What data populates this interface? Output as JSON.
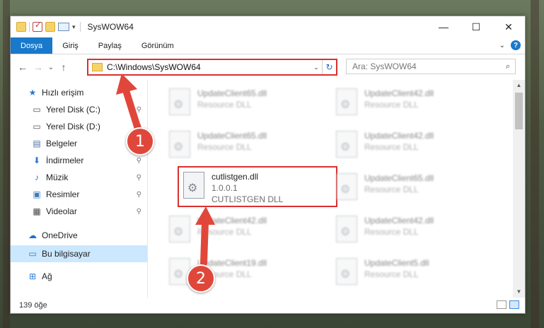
{
  "window": {
    "title": "SysWOW64",
    "controls": {
      "minimize": "—",
      "maximize": "☐",
      "close": "✕"
    }
  },
  "ribbon": {
    "tabs": [
      "Dosya",
      "Giriş",
      "Paylaş",
      "Görünüm"
    ],
    "help": "?",
    "expand": "⌄"
  },
  "nav": {
    "back": "←",
    "forward": "→",
    "recent": "⌄",
    "up": "↑",
    "address": "C:\\Windows\\SysWOW64",
    "refresh": "↻",
    "search_placeholder": "Ara: SysWOW64"
  },
  "sidebar": {
    "items": [
      {
        "label": "Hızlı erişim",
        "icon": "star-icon",
        "pinned": false
      },
      {
        "label": "Yerel Disk (C:)",
        "icon": "drive-icon",
        "pinned": true
      },
      {
        "label": "Yerel Disk (D:)",
        "icon": "drive-icon",
        "pinned": true
      },
      {
        "label": "Belgeler",
        "icon": "documents-icon",
        "pinned": true
      },
      {
        "label": "İndirmeler",
        "icon": "download-icon",
        "pinned": true
      },
      {
        "label": "Müzik",
        "icon": "music-icon",
        "pinned": true
      },
      {
        "label": "Resimler",
        "icon": "pictures-icon",
        "pinned": true
      },
      {
        "label": "Videolar",
        "icon": "video-icon",
        "pinned": true
      },
      {
        "label": "OneDrive",
        "icon": "cloud-icon",
        "pinned": false
      },
      {
        "label": "Bu bilgisayar",
        "icon": "computer-icon",
        "pinned": false,
        "selected": true
      },
      {
        "label": "Ağ",
        "icon": "network-icon",
        "pinned": false
      }
    ],
    "pin_glyph": "📌"
  },
  "files": {
    "left": [
      {
        "name": "UpdateClient65.dll",
        "type": "Resource DLL"
      },
      {
        "name": "UpdateClient65.dll",
        "type": "Resource DLL"
      },
      {
        "name": "cutlistgen.dll",
        "version": "1.0.0.1",
        "type": "CUTLISTGEN DLL",
        "highlighted": true
      },
      {
        "name": "UpdateClient42.dll",
        "type": "Resource DLL"
      },
      {
        "name": "UpdateClient19.dll",
        "type": "Resource DLL"
      }
    ],
    "right": [
      {
        "name": "UpdateClient42.dll",
        "type": "Resource DLL"
      },
      {
        "name": "UpdateClient42.dll",
        "type": "Resource DLL"
      },
      {
        "name": "UpdateClient65.dll",
        "type": "Resource DLL"
      },
      {
        "name": "UpdateClient42.dll",
        "type": "Resource DLL"
      },
      {
        "name": "UpdateClient5.dll",
        "type": "Resource DLL"
      }
    ]
  },
  "status": {
    "count": "139 öğe"
  },
  "callouts": [
    "1",
    "2"
  ],
  "colors": {
    "accent": "#1979ca",
    "highlight": "#d9312f",
    "badge": "#e0473a",
    "selection": "#cce8ff"
  }
}
